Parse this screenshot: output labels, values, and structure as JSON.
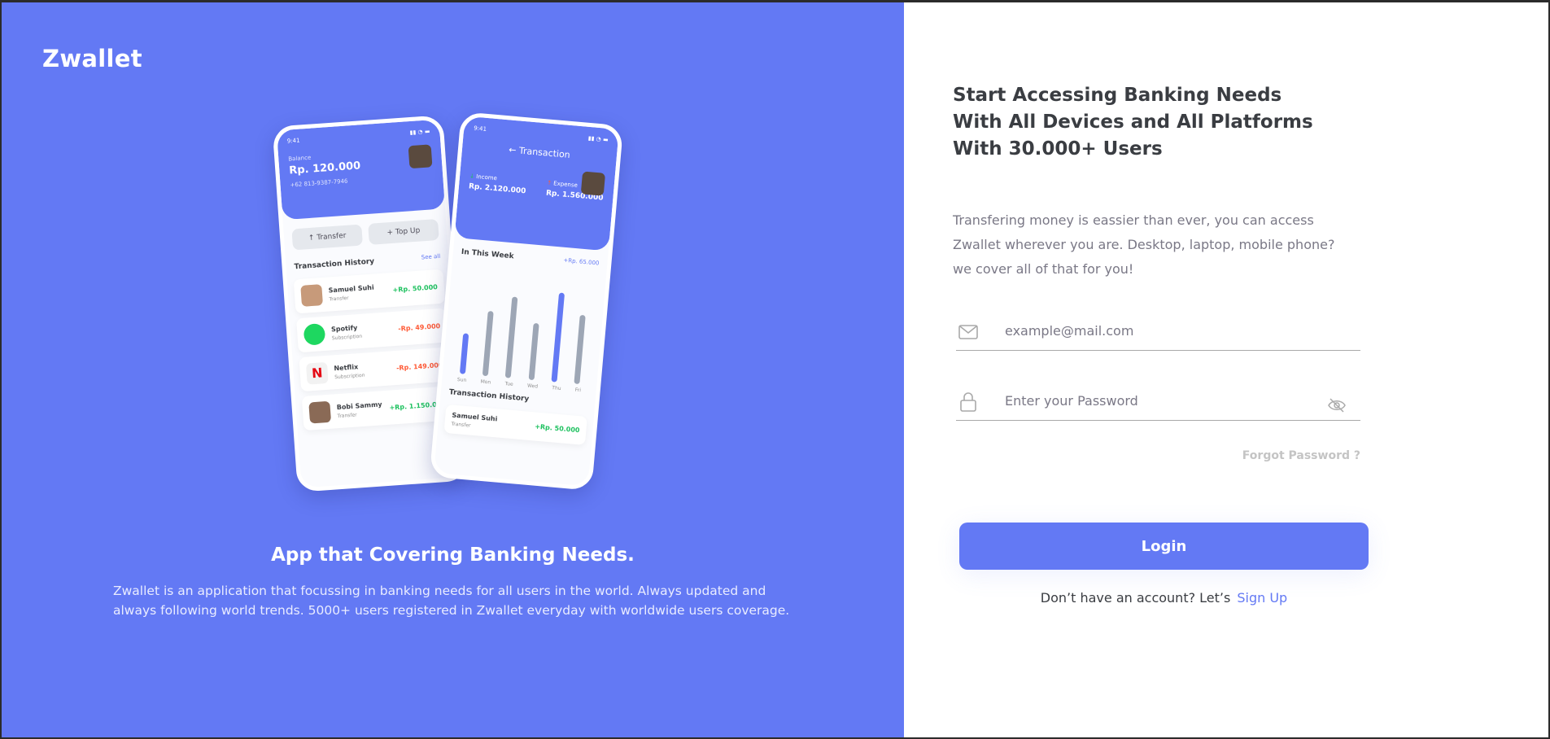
{
  "brand": "Zwallet",
  "hero": {
    "tagline": "App that Covering Banking Needs.",
    "description": "Zwallet is an application that focussing in banking needs for all users in the world. Always updated and always following world trends. 5000+ users registered in Zwallet everyday with worldwide users coverage."
  },
  "phone1": {
    "time": "9:41",
    "balance_label": "Balance",
    "balance": "Rp. 120.000",
    "phone": "+62 813-9387-7946",
    "transfer_label": "Transfer",
    "topup_label": "Top Up",
    "history_title": "Transaction History",
    "see_all": "See all",
    "transactions": [
      {
        "name": "Samuel Suhi",
        "type": "Transfer",
        "amount": "+Rp. 50.000"
      },
      {
        "name": "Spotify",
        "type": "Subscription",
        "amount": "-Rp. 49.000"
      },
      {
        "name": "Netflix",
        "type": "Subscription",
        "amount": "-Rp. 149.000"
      },
      {
        "name": "Bobi Sammy",
        "type": "Transfer",
        "amount": "+Rp. 1.150.000"
      }
    ]
  },
  "phone2": {
    "time": "9:41",
    "title": "Transaction",
    "income_label": "Income",
    "income": "Rp. 2.120.000",
    "expense_label": "Expense",
    "expense": "Rp. 1.560.000",
    "week_title": "In This Week",
    "tooltip": "+Rp. 65.000",
    "days": [
      "Sun",
      "Mon",
      "Tue",
      "Wed",
      "Thu",
      "Fri"
    ],
    "history_title": "Transaction History",
    "last_name": "Samuel Suhi",
    "last_type": "Transfer",
    "last_amount": "+Rp. 50.000"
  },
  "login": {
    "heading": "Start Accessing Banking Needs With All Devices and All Platforms With 30.000+ Users",
    "description": "Transfering money is eassier than ever, you can access Zwallet wherever you are. Desktop, laptop, mobile phone? we cover all of that for you!",
    "email_placeholder": "example@mail.com",
    "password_placeholder": "Enter your Password",
    "forgot": "Forgot Password ?",
    "login_button": "Login",
    "signup_prompt": "Don’t have an account? Let’s",
    "signup_link": "Sign Up"
  },
  "colors": {
    "primary": "#6379F4",
    "income": "#1EC15F",
    "expense": "#FF5B37"
  }
}
